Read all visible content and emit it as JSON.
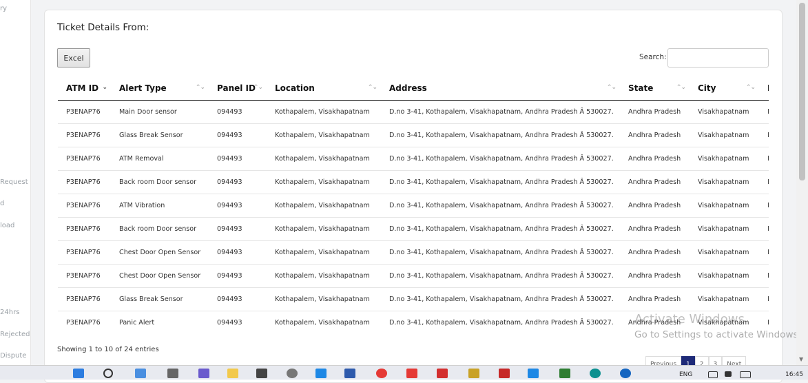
{
  "sidebar": {
    "items": [
      "ry",
      "Request",
      "d",
      "load",
      "24hrs",
      "Rejected",
      "Dispute"
    ]
  },
  "card": {
    "title": "Ticket Details From:",
    "excel_label": "Excel",
    "search_label": "Search:",
    "search_value": ""
  },
  "table": {
    "columns": [
      "ATM ID",
      "Alert Type",
      "Panel ID",
      "Location",
      "Address",
      "State",
      "City",
      "I"
    ],
    "rows": [
      [
        "P3ENAP76",
        "Main Door sensor",
        "094493",
        "Kothapalem, Visakhapatnam",
        "D.no 3-41, Kothapalem, Visakhapatnam, Andhra Pradesh Â 530027.",
        "Andhra Pradesh",
        "Visakhapatnam",
        "I"
      ],
      [
        "P3ENAP76",
        "Glass Break Sensor",
        "094493",
        "Kothapalem, Visakhapatnam",
        "D.no 3-41, Kothapalem, Visakhapatnam, Andhra Pradesh Â 530027.",
        "Andhra Pradesh",
        "Visakhapatnam",
        "I"
      ],
      [
        "P3ENAP76",
        "ATM Removal",
        "094493",
        "Kothapalem, Visakhapatnam",
        "D.no 3-41, Kothapalem, Visakhapatnam, Andhra Pradesh Â 530027.",
        "Andhra Pradesh",
        "Visakhapatnam",
        "I"
      ],
      [
        "P3ENAP76",
        "Back room Door sensor",
        "094493",
        "Kothapalem, Visakhapatnam",
        "D.no 3-41, Kothapalem, Visakhapatnam, Andhra Pradesh Â 530027.",
        "Andhra Pradesh",
        "Visakhapatnam",
        "I"
      ],
      [
        "P3ENAP76",
        "ATM Vibration",
        "094493",
        "Kothapalem, Visakhapatnam",
        "D.no 3-41, Kothapalem, Visakhapatnam, Andhra Pradesh Â 530027.",
        "Andhra Pradesh",
        "Visakhapatnam",
        "I"
      ],
      [
        "P3ENAP76",
        "Back room Door sensor",
        "094493",
        "Kothapalem, Visakhapatnam",
        "D.no 3-41, Kothapalem, Visakhapatnam, Andhra Pradesh Â 530027.",
        "Andhra Pradesh",
        "Visakhapatnam",
        "I"
      ],
      [
        "P3ENAP76",
        "Chest Door Open Sensor",
        "094493",
        "Kothapalem, Visakhapatnam",
        "D.no 3-41, Kothapalem, Visakhapatnam, Andhra Pradesh Â 530027.",
        "Andhra Pradesh",
        "Visakhapatnam",
        "I"
      ],
      [
        "P3ENAP76",
        "Chest Door Open Sensor",
        "094493",
        "Kothapalem, Visakhapatnam",
        "D.no 3-41, Kothapalem, Visakhapatnam, Andhra Pradesh Â 530027.",
        "Andhra Pradesh",
        "Visakhapatnam",
        "I"
      ],
      [
        "P3ENAP76",
        "Glass Break Sensor",
        "094493",
        "Kothapalem, Visakhapatnam",
        "D.no 3-41, Kothapalem, Visakhapatnam, Andhra Pradesh Â 530027.",
        "Andhra Pradesh",
        "Visakhapatnam",
        "I"
      ],
      [
        "P3ENAP76",
        "Panic Alert",
        "094493",
        "Kothapalem, Visakhapatnam",
        "D.no 3-41, Kothapalem, Visakhapatnam, Andhra Pradesh Â 530027.",
        "Andhra Pradesh",
        "Visakhapatnam",
        "I"
      ]
    ]
  },
  "footer": {
    "info": "Showing 1 to 10 of 24 entries",
    "pagination": [
      "Previous",
      "1",
      "2",
      "3",
      "Next"
    ],
    "active_page": "1"
  },
  "watermark": {
    "line1": "Activate Windows",
    "line2": "Go to Settings to activate Windows."
  },
  "taskbar": {
    "lang": "ENG",
    "time": "16:45"
  },
  "colors": {
    "accent": "#1e2a78",
    "header_border": "#111111"
  }
}
